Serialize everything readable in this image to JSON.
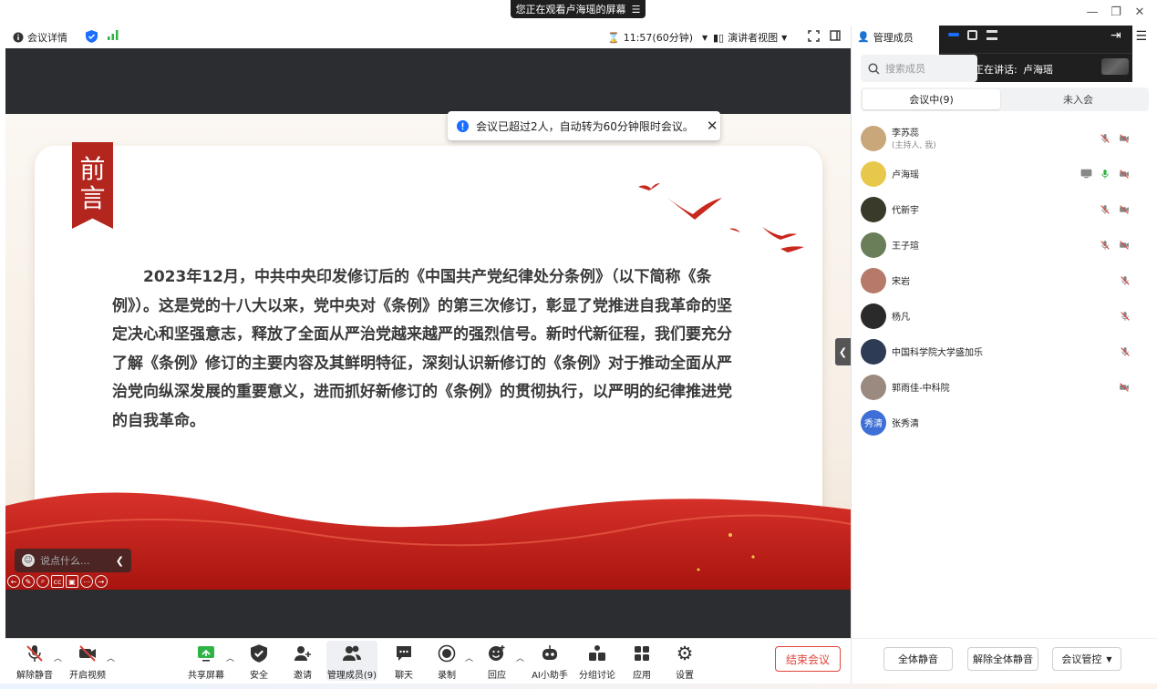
{
  "window": {
    "sharing_banner": "您正在观看卢海瑶的屏幕",
    "banner_icon": "menu-icon"
  },
  "infobar": {
    "meeting_info": "会议详情",
    "timer": "11:57(60分钟)",
    "view_mode": "演讲者视图"
  },
  "notice": {
    "text": "会议已超过2人，自动转为60分钟限时会议。"
  },
  "slide": {
    "ribbon_text": "前言",
    "body": "2023年12月，中共中央印发修订后的《中国共产党纪律处分条例》（以下简称《条例》）。这是党的十八大以来，党中央对《条例》的第三次修订，彰显了党推进自我革命的坚定决心和坚强意志，释放了全面从严治党越来越严的强烈信号。新时代新征程，我们要充分了解《条例》修订的主要内容及其鲜明特征，深刻认识新修订的《条例》对于推动全面从严治党向纵深发展的重要意义，进而抓好新修订的《条例》的贯彻执行，以严明的纪律推进党的自我革命。"
  },
  "chat": {
    "placeholder": "说点什么..."
  },
  "toolbar": {
    "unmute": "解除静音",
    "start_video": "开启视频",
    "share_screen": "共享屏幕",
    "security": "安全",
    "invite": "邀请",
    "manage_members": "管理成员(9)",
    "chat": "聊天",
    "record": "录制",
    "reactions": "回应",
    "ai_assistant": "AI小助手",
    "breakout": "分组讨论",
    "apps": "应用",
    "settings": "设置",
    "end_meeting": "结束会议"
  },
  "panel": {
    "title": "管理成员",
    "speaking_label": "正在讲话:",
    "speaking_name": "卢海瑶",
    "search_placeholder": "搜索成员",
    "tab_in_meeting": "会议中(9)",
    "tab_not_joined": "未入会",
    "members": [
      {
        "name": "李苏蕊",
        "sub": "(主持人, 我)",
        "mic": "muted",
        "video": "off",
        "screen": false,
        "avatar_color": "#c9a77a"
      },
      {
        "name": "卢海瑶",
        "sub": "",
        "mic": "on",
        "video": "off",
        "screen": true,
        "avatar_color": "#e8c84a"
      },
      {
        "name": "代新宇",
        "sub": "",
        "mic": "muted",
        "video": "off",
        "screen": false,
        "avatar_color": "#3a3a2a"
      },
      {
        "name": "王子瑄",
        "sub": "",
        "mic": "muted",
        "video": "off",
        "screen": false,
        "avatar_color": "#6b7e5a"
      },
      {
        "name": "宋岩",
        "sub": "",
        "mic": "muted",
        "video": "none",
        "screen": false,
        "avatar_color": "#b57a6a"
      },
      {
        "name": "杨凡",
        "sub": "",
        "mic": "muted",
        "video": "none",
        "screen": false,
        "avatar_color": "#2a2a2a"
      },
      {
        "name": "中国科学院大学盛加乐",
        "sub": "",
        "mic": "muted",
        "video": "none",
        "screen": false,
        "avatar_color": "#2d3b55"
      },
      {
        "name": "郭雨佳-中科院",
        "sub": "",
        "mic": "none",
        "video": "off",
        "screen": false,
        "avatar_color": "#9a8a80"
      },
      {
        "name": "张秀清",
        "sub": "",
        "mic": "none",
        "video": "none",
        "screen": false,
        "avatar_color": "#3d6fd6",
        "avatar_text": "秀清"
      }
    ],
    "mute_all": "全体静音",
    "unmute_all": "解除全体静音",
    "meeting_control": "会议管控"
  },
  "colors": {
    "accent_blue": "#1a6dff",
    "end_red": "#e0453a",
    "ribbon_red": "#b3261e",
    "mic_muted": "#d9443a",
    "mic_on": "#2fb344"
  }
}
